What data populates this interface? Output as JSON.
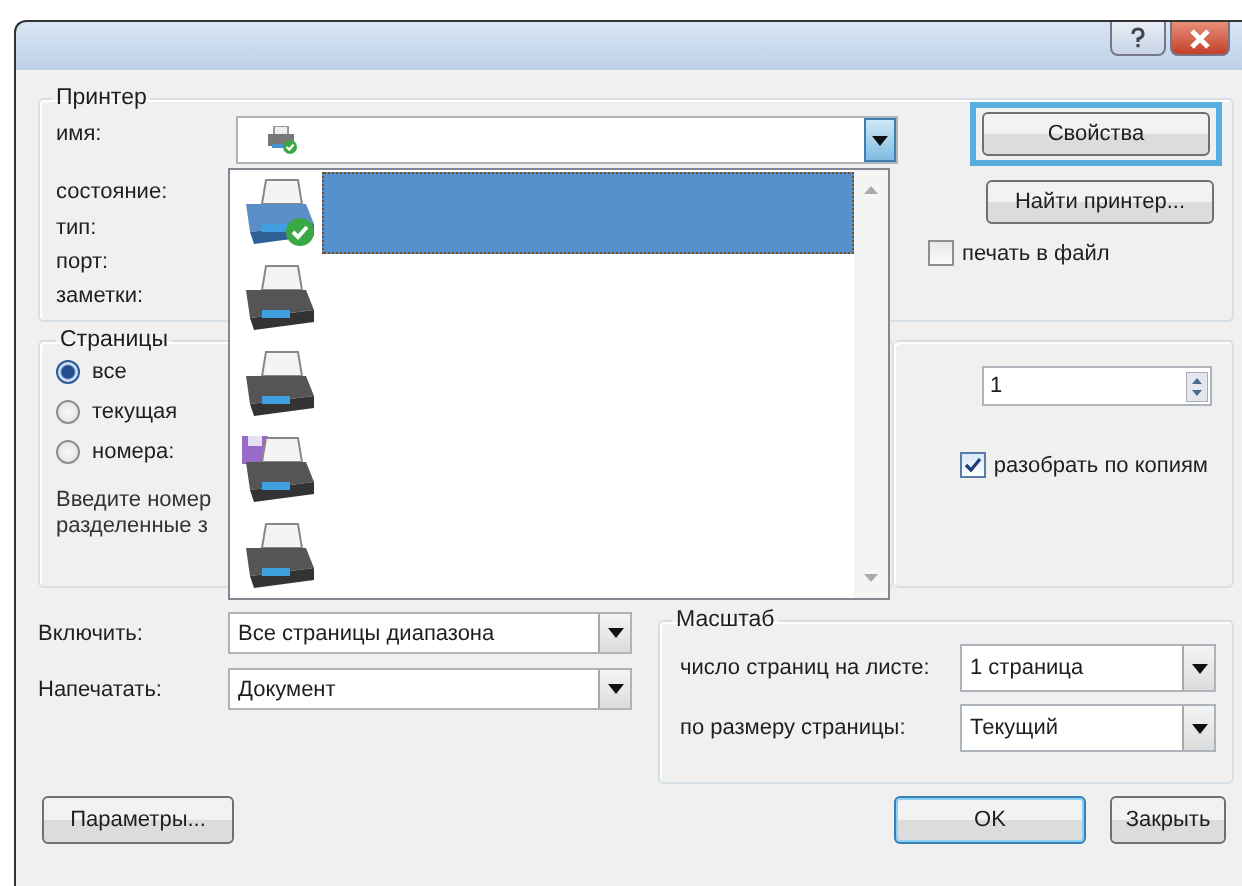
{
  "printer": {
    "title": "Принтер",
    "name_label": "имя:",
    "name_combo": {
      "expanded": true
    },
    "info_labels": [
      "состояние:",
      "тип:",
      "порт:",
      "заметки:"
    ],
    "properties_button": "Свойства",
    "find_button": "Найти принтер...",
    "print_to_file": {
      "label": "печать в файл",
      "checked": false
    }
  },
  "printer_list": [
    {
      "kind": "default",
      "selected": true
    },
    {
      "kind": "printer",
      "selected": false
    },
    {
      "kind": "printer",
      "selected": false
    },
    {
      "kind": "fax",
      "selected": false
    },
    {
      "kind": "printer",
      "selected": false
    }
  ],
  "pages": {
    "title": "Страницы",
    "options": [
      {
        "label": "все",
        "selected": true
      },
      {
        "label": "текущая",
        "selected": false
      },
      {
        "label": "номера:",
        "selected": false
      }
    ],
    "hint_lines": [
      "Введите номер",
      "разделенные з"
    ]
  },
  "copies": {
    "count": "1",
    "collate": {
      "label": "разобрать по копиям",
      "checked": true
    }
  },
  "include": {
    "label": "Включить:",
    "value": "Все страницы диапазона"
  },
  "print_what": {
    "label": "Напечатать:",
    "value": "Документ"
  },
  "scale": {
    "title": "Масштаб",
    "rows": [
      {
        "label": "число страниц на листе:",
        "value": "1 страница"
      },
      {
        "label": "по размеру страницы:",
        "value": "Текущий"
      }
    ]
  },
  "buttons": [
    {
      "label": "Параметры...",
      "kind": "options"
    },
    {
      "label": "OK",
      "kind": "default"
    },
    {
      "label": "Закрыть",
      "kind": "close"
    }
  ]
}
